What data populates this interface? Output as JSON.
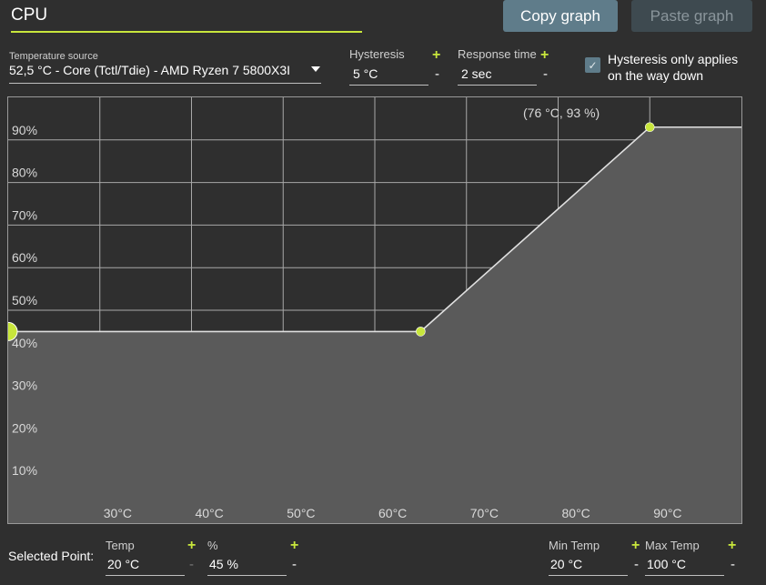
{
  "header": {
    "title": "CPU",
    "copy_label": "Copy graph",
    "paste_label": "Paste graph"
  },
  "controls": {
    "source_label": "Temperature source",
    "source_value": "52,5 °C - Core (Tctl/Tdie) - AMD Ryzen 7 5800X3I",
    "hysteresis_label": "Hysteresis",
    "hysteresis_value": "5 °C",
    "response_label": "Response time",
    "response_value": "2 sec",
    "plus": "+",
    "minus": "-",
    "checkbox_label_line1": "Hysteresis only applies",
    "checkbox_label_line2": "on the way down",
    "checkbox_checked": true,
    "check_glyph": "✓"
  },
  "graph": {
    "tooltip": "(76 °C, 93 %)",
    "y_tick_labels": [
      "90%",
      "80%",
      "70%",
      "60%",
      "50%",
      "40%",
      "30%",
      "20%",
      "10%"
    ],
    "x_tick_labels": [
      "30°C",
      "40°C",
      "50°C",
      "60°C",
      "70°C",
      "80°C",
      "90°C"
    ],
    "accent": "#c8e63c"
  },
  "chart_data": {
    "type": "line",
    "x": [
      20,
      65,
      90,
      100
    ],
    "y": [
      45,
      45,
      93,
      93
    ],
    "xlim": [
      20,
      100
    ],
    "ylim": [
      0,
      100
    ],
    "grid": true,
    "points": [
      {
        "temp": 20,
        "percent": 45
      },
      {
        "temp": 65,
        "percent": 45
      },
      {
        "temp": 90,
        "percent": 93
      }
    ]
  },
  "selected_point": {
    "label": "Selected Point:",
    "temp_label": "Temp",
    "temp_value": "20 °C",
    "percent_label": "%",
    "percent_value": "45 %",
    "min_temp_label": "Min Temp",
    "min_temp_value": "20 °C",
    "max_temp_label": "Max Temp",
    "max_temp_value": "100 °C"
  }
}
